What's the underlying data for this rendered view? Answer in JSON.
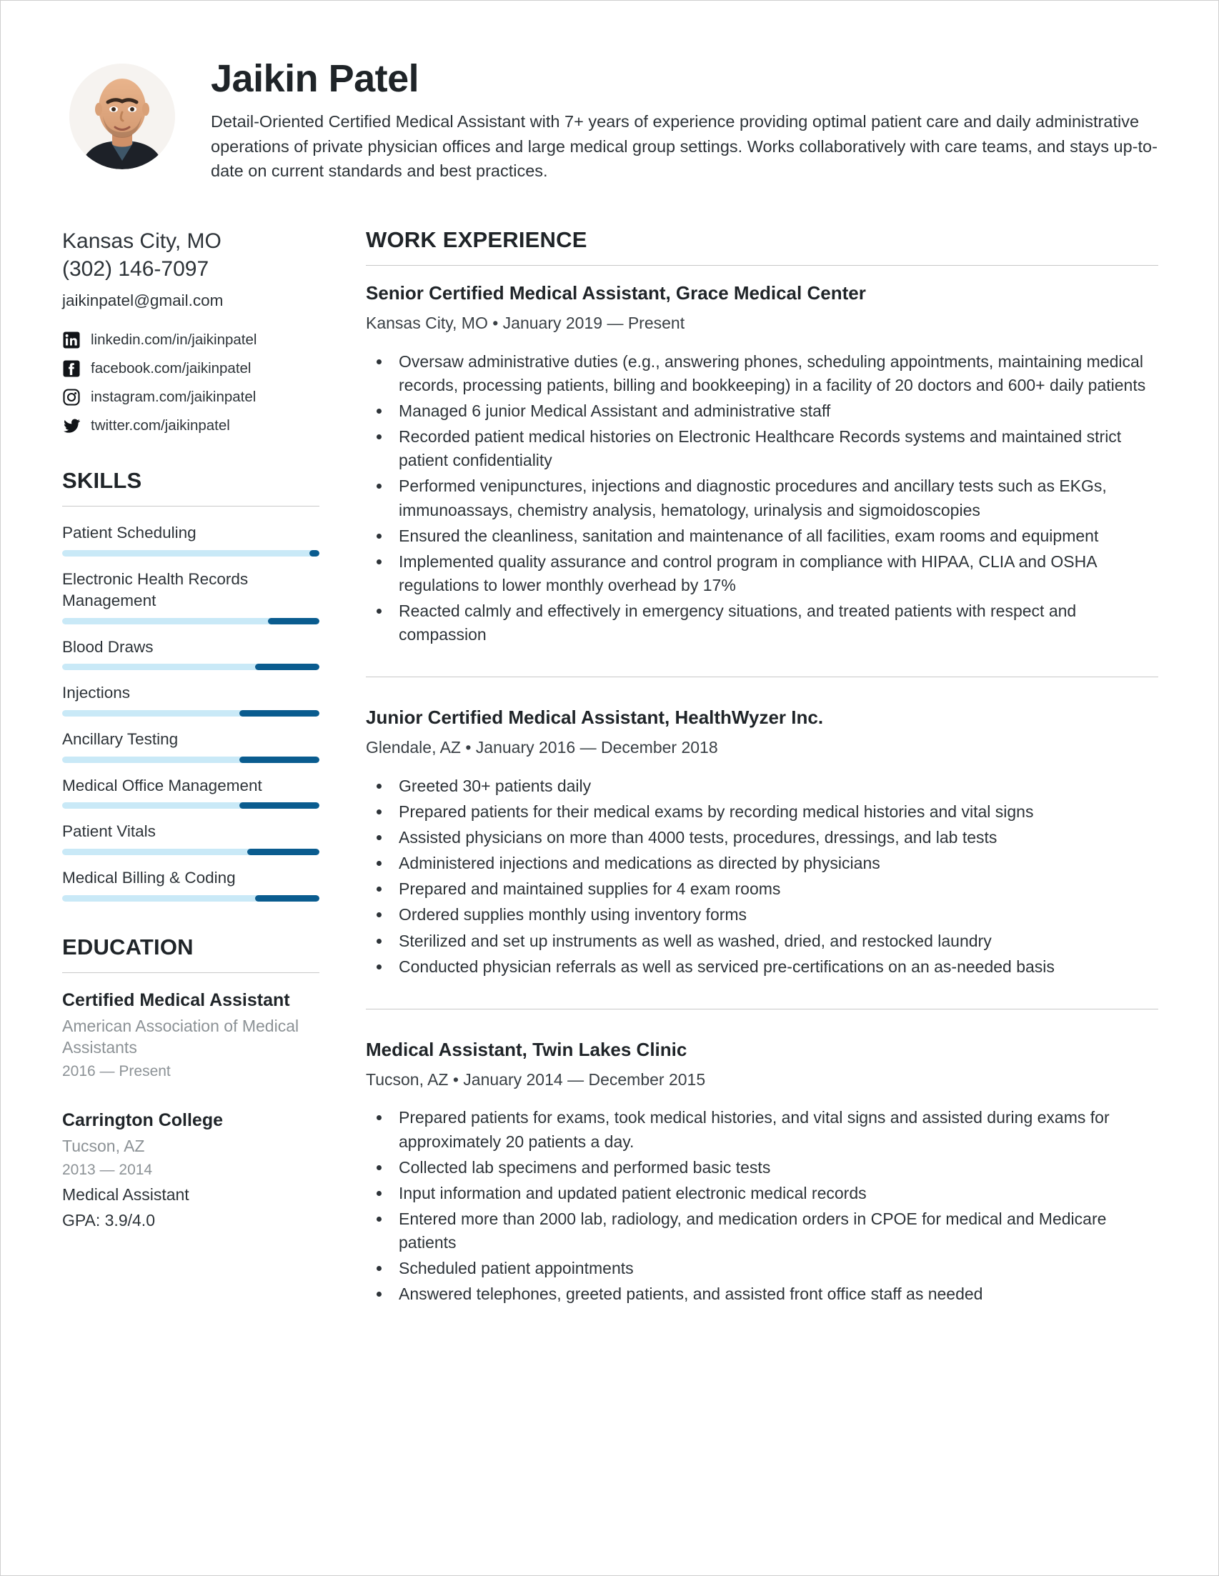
{
  "profile": {
    "name": "Jaikin Patel",
    "summary": "Detail-Oriented Certified Medical Assistant with 7+ years of experience providing optimal patient care and daily administrative operations of private physician offices and large medical group settings. Works collaboratively with care teams, and stays up-to-date on current standards and best practices.",
    "avatar_alt": "profile-photo"
  },
  "contact": {
    "location": "Kansas City, MO",
    "phone": "(302) 146-7097",
    "email": "jaikinpatel@gmail.com",
    "socials": [
      {
        "icon": "linkedin-icon",
        "label": "linkedin.com/in/jaikinpatel"
      },
      {
        "icon": "facebook-icon",
        "label": "facebook.com/jaikinpatel"
      },
      {
        "icon": "instagram-icon",
        "label": "instagram.com/jaikinpatel"
      },
      {
        "icon": "twitter-icon",
        "label": "twitter.com/jaikinpatel"
      }
    ]
  },
  "skills": {
    "heading": "SKILLS",
    "items": [
      {
        "label": "Patient Scheduling",
        "level": 4
      },
      {
        "label": "Electronic Health Records Management",
        "level": 20
      },
      {
        "label": "Blood Draws",
        "level": 25
      },
      {
        "label": "Injections",
        "level": 31
      },
      {
        "label": "Ancillary Testing",
        "level": 31
      },
      {
        "label": "Medical Office Management",
        "level": 31
      },
      {
        "label": "Patient Vitals",
        "level": 28
      },
      {
        "label": "Medical Billing & Coding",
        "level": 25
      }
    ]
  },
  "education": {
    "heading": "EDUCATION",
    "items": [
      {
        "degree": "Certified Medical Assistant",
        "school": "American Association of Medical Assistants",
        "dates": "2016 — Present",
        "extra": []
      },
      {
        "degree": "Carrington College",
        "school": "Tucson, AZ",
        "dates": "2013 — 2014",
        "extra": [
          "Medical Assistant",
          "GPA: 3.9/4.0"
        ]
      }
    ]
  },
  "work": {
    "heading": "WORK EXPERIENCE",
    "jobs": [
      {
        "title": "Senior Certified Medical Assistant, Grace Medical Center",
        "meta": "Kansas City, MO • January 2019 — Present",
        "bullets": [
          "Oversaw administrative duties (e.g., answering phones, scheduling appointments, maintaining medical records, processing patients, billing and bookkeeping) in a facility of 20 doctors and 600+ daily patients",
          "Managed 6 junior Medical Assistant and administrative staff",
          "Recorded patient medical histories on Electronic Healthcare Records systems and maintained strict patient confidentiality",
          "Performed venipunctures, injections and diagnostic procedures and ancillary tests such as EKGs, immunoassays, chemistry analysis, hematology, urinalysis and sigmoidoscopies",
          "Ensured the cleanliness, sanitation and maintenance of all facilities, exam rooms and equipment",
          "Implemented quality assurance and control program in compliance with HIPAA, CLIA and OSHA regulations to lower monthly overhead by 17%",
          "Reacted calmly and effectively in emergency situations, and treated patients with respect and compassion"
        ]
      },
      {
        "title": "Junior Certified Medical Assistant, HealthWyzer Inc.",
        "meta": "Glendale, AZ • January 2016 — December 2018",
        "bullets": [
          "Greeted 30+ patients daily",
          "Prepared patients for their medical exams by recording medical histories and vital signs",
          "Assisted physicians on more than 4000 tests, procedures, dressings, and lab tests",
          "Administered injections and medications as directed by physicians",
          "Prepared and maintained supplies for 4 exam rooms",
          "Ordered supplies monthly using inventory forms",
          "Sterilized and set up instruments as well as washed, dried, and restocked laundry",
          "Conducted physician referrals as well as serviced pre-certifications on an as-needed basis"
        ]
      },
      {
        "title": "Medical Assistant, Twin Lakes Clinic",
        "meta": "Tucson, AZ • January 2014 — December 2015",
        "bullets": [
          "Prepared patients for exams, took medical histories, and vital signs and assisted during exams for approximately 20 patients a day.",
          "Collected lab specimens and performed basic tests",
          "Input information and updated patient electronic medical records",
          "Entered more than 2000 lab, radiology, and medication orders in CPOE for medical and Medicare patients",
          "Scheduled patient appointments",
          "Answered telephones, greeted patients, and assisted front office staff as needed"
        ]
      }
    ]
  },
  "colors": {
    "skill_track": "#c9e9f7",
    "skill_fill": "#0a5c8f",
    "text": "#2d3338",
    "heading": "#1f2428",
    "muted": "#8c9296",
    "rule": "#c8c8c8"
  }
}
